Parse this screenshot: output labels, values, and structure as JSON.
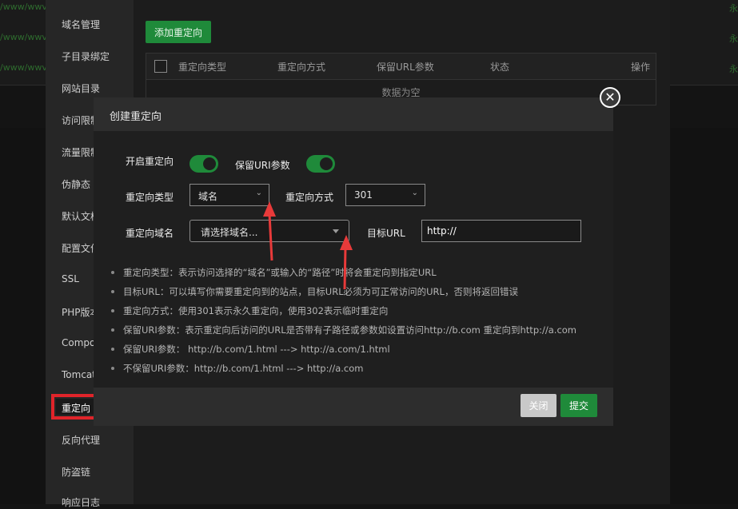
{
  "background": {
    "rows": [
      {
        "url": "/www/wwv",
        "status": "永"
      },
      {
        "url": "/www/wwv",
        "status": "永"
      },
      {
        "url": "/www/wwv",
        "status": "永"
      }
    ]
  },
  "sidebar": {
    "items": [
      {
        "label": "域名管理"
      },
      {
        "label": "子目录绑定"
      },
      {
        "label": "网站目录"
      },
      {
        "label": "访问限制"
      },
      {
        "label": "流量限制"
      },
      {
        "label": "伪静态"
      },
      {
        "label": "默认文档"
      },
      {
        "label": "配置文件"
      },
      {
        "label": "SSL"
      },
      {
        "label": "PHP版本"
      },
      {
        "label": "Composer"
      },
      {
        "label": "Tomcat"
      },
      {
        "label": "重定向"
      },
      {
        "label": "反向代理"
      },
      {
        "label": "防盗链"
      },
      {
        "label": "响应日志"
      }
    ]
  },
  "toolbar": {
    "add_label": "添加重定向"
  },
  "table": {
    "headers": [
      "重定向类型",
      "重定向方式",
      "保留URL参数",
      "状态",
      "操作"
    ],
    "empty_text": "数据为空"
  },
  "modal": {
    "title": "创建重定向",
    "enable_label": "开启重定向",
    "keep_uri_label": "保留URI参数",
    "type_label": "重定向类型",
    "type_value": "域名",
    "method_label": "重定向方式",
    "method_value": "301",
    "domain_label": "重定向域名",
    "domain_placeholder": "请选择域名...",
    "target_label": "目标URL",
    "target_value": "http://",
    "tips": [
      "重定向类型：表示访问选择的“域名”或输入的“路径”时将会重定向到指定URL",
      "目标URL：可以填写你需要重定向到的站点，目标URL必须为可正常访问的URL，否则将返回错误",
      "重定向方式：使用301表示永久重定向，使用302表示临时重定向",
      "保留URI参数：表示重定向后访问的URL是否带有子路径或参数如设置访问http://b.com 重定向到http://a.com",
      "保留URI参数： http://b.com/1.html ---> http://a.com/1.html",
      "不保留URI参数：http://b.com/1.html ---> http://a.com"
    ],
    "close_label": "关闭",
    "submit_label": "提交"
  },
  "colors": {
    "accent_green": "#1f8a3a",
    "highlight_red": "#e0242a",
    "annotation_arrow_red": "#e83a3a"
  }
}
